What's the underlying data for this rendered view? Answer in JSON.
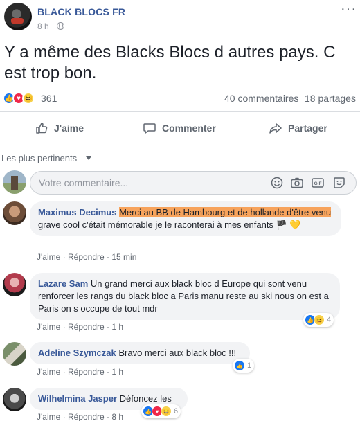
{
  "post": {
    "page_name": "BLACK BLOCS FR",
    "time": "8 h",
    "text": "Y a même des Blacks Blocs d autres pays. C est trop bon.",
    "reaction_count": "361",
    "comments_count": "40 commentaires",
    "shares_count": "18 partages"
  },
  "actions": {
    "like": "J'aime",
    "comment": "Commenter",
    "share": "Partager"
  },
  "sort": {
    "label": "Les plus pertinents"
  },
  "composer": {
    "placeholder": "Votre commentaire..."
  },
  "comments": [
    {
      "author": "Maximus Decimus",
      "text_highlighted": "Merci au BB de Hambourg et de hollande d'être venu",
      "text_rest": " grave cool c'était mémorable je le raconterai à mes enfants 🏴 💛",
      "like": "J'aime",
      "reply": "Répondre",
      "time": "15 min"
    },
    {
      "author": "Lazare Sam",
      "text": "Un grand merci aux black bloc d Europe qui sont venu renforcer les rangs du black bloc a Paris manu reste au ski nous on est a Paris on s occupe de tout mdr",
      "like": "J'aime",
      "reply": "Répondre",
      "time": "1 h",
      "reactions": "4"
    },
    {
      "author": "Adeline Szymczak",
      "text": "Bravo merci aux black bloc !!!",
      "like": "J'aime",
      "reply": "Répondre",
      "time": "1 h",
      "reactions": "1"
    },
    {
      "author": "Wilhelmina Jasper",
      "text": "Défoncez les",
      "like": "J'aime",
      "reply": "Répondre",
      "time": "8 h",
      "reactions": "6"
    }
  ],
  "icons": {
    "like": "like-icon",
    "comment": "comment-icon",
    "share": "share-icon",
    "globe": "globe-icon",
    "more": "more-icon",
    "emoji": "emoji-icon",
    "camera": "camera-icon",
    "gif": "gif-icon",
    "sticker": "sticker-icon"
  },
  "colors": {
    "link": "#385898",
    "highlight": "#f7a35c",
    "like_blue": "#1877f2",
    "love_red": "#f0284a",
    "haha_yellow": "#f7d14b"
  }
}
